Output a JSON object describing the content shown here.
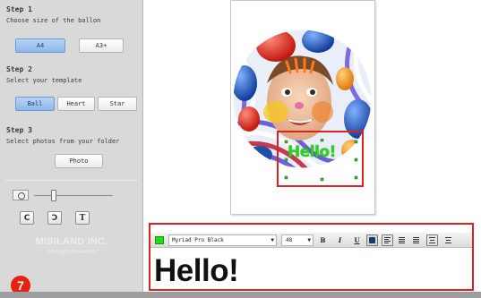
{
  "sidebar": {
    "step1": {
      "title": "Step 1",
      "desc": "Choose size of the ballon",
      "options": [
        "A4",
        "A3+"
      ],
      "selected": "A4"
    },
    "step2": {
      "title": "Step 2",
      "desc": "Select your template",
      "options": [
        "Ball",
        "Heart",
        "Star"
      ],
      "selected": "Ball"
    },
    "step3": {
      "title": "Step 3",
      "desc": "Select photos from your folder",
      "button": "Photo"
    },
    "zoom": {
      "level": 0.25
    },
    "tools": [
      {
        "icon": "rotate-left-icon",
        "glyph": "C"
      },
      {
        "icon": "rotate-right-icon",
        "glyph": "Ɔ"
      },
      {
        "icon": "text-tool-icon",
        "glyph": "T"
      }
    ],
    "brand": "MISILAND INC.",
    "rights": "All Rights Reserved"
  },
  "badge": "7",
  "canvas": {
    "overlay_text": "Hello!",
    "overlay_color": "#2bd21f"
  },
  "editor": {
    "text_color": "#22e00f",
    "font": "Myriad Pro Black",
    "size": "48",
    "buttons": {
      "bold": "B",
      "italic": "I",
      "underline": "U"
    },
    "text": "Hello!"
  },
  "colors": {
    "selection_red": "#d9251d",
    "sidebar_bg": "#d9d9d9",
    "badge_red": "#e8210f",
    "active_blue": "#8fb6ea"
  }
}
